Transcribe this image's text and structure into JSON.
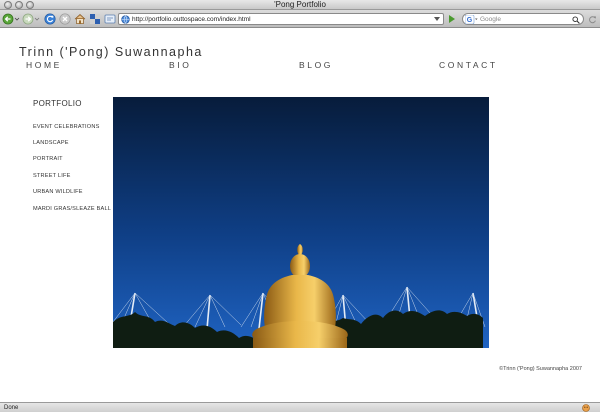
{
  "window": {
    "title": "'Pong Portfolio"
  },
  "toolbar": {
    "url": "http://portfolio.outtospace.com/index.html",
    "search_placeholder": "Google",
    "buttons": [
      "back-icon",
      "forward-icon",
      "reload-icon",
      "stop-icon",
      "home-icon",
      "bookmark-icon",
      "tab-icon"
    ]
  },
  "page": {
    "site_title": "Trinn ('Pong) Suwannapha",
    "nav": [
      "HOME",
      "BIO",
      "BLOG",
      "CONTACT"
    ],
    "sidebar_heading": "PORTFOLIO",
    "sidebar_items": [
      "EVENT CELEBRATIONS",
      "LANDSCAPE",
      "PORTRAIT",
      "STREET LIFE",
      "URBAN WILDLIFE",
      "MARDI GRAS/SLEAZE BALL"
    ],
    "copyright": "©Trinn ('Pong) Suwannapha 2007"
  },
  "status": {
    "text": "Done"
  },
  "colors": {
    "sky_top": "#071c3b",
    "sky_bottom": "#1f63c2",
    "statue_gold": "#d9a33a"
  }
}
